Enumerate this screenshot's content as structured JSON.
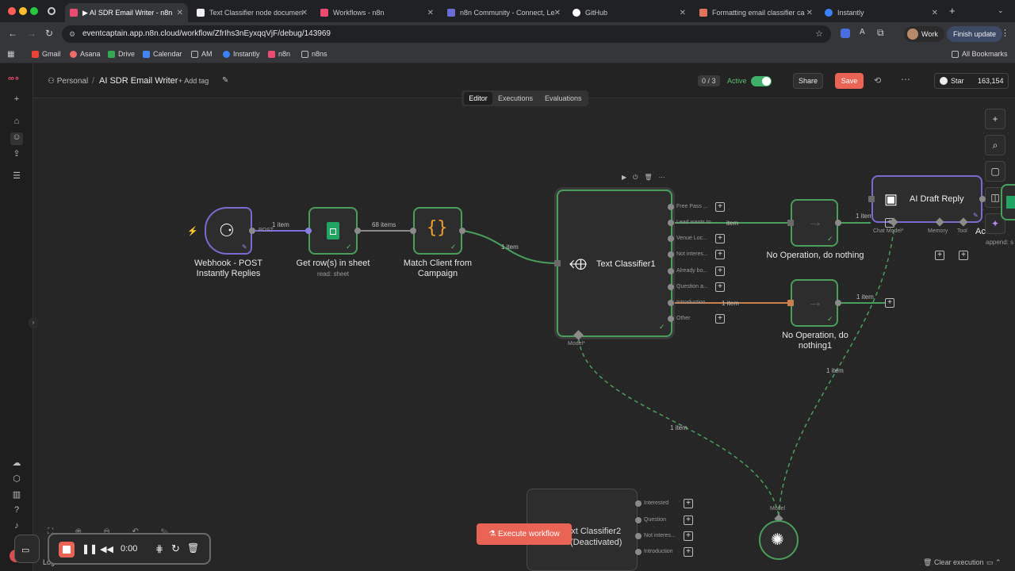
{
  "browser": {
    "tabs": [
      {
        "label": "▶ AI SDR Email Writer - n8n",
        "active": true
      },
      {
        "label": "Text Classifier node documen"
      },
      {
        "label": "Workflows - n8n"
      },
      {
        "label": "n8n Community - Connect, Le"
      },
      {
        "label": "GitHub"
      },
      {
        "label": "Formatting email classifier ca"
      },
      {
        "label": "Instantly"
      }
    ],
    "url": "eventcaptain.app.n8n.cloud/workflow/ZfrIhs3nEyxqqVjF/debug/143969",
    "profile": "Work",
    "finish_update": "Finish update",
    "bookmarks": [
      "Gmail",
      "Asana",
      "Drive",
      "Calendar",
      "AM",
      "Instantly",
      "n8n",
      "n8ns"
    ],
    "all_bookmarks": "All Bookmarks"
  },
  "header": {
    "breadcrumb_owner": "Personal",
    "workflow_name": "AI SDR Email Writer",
    "add_tag": "+ Add tag",
    "counter": "0 / 3",
    "active_label": "Active",
    "share": "Share",
    "save": "Save",
    "star": "Star",
    "star_count": "163,154"
  },
  "tabs": [
    "Editor",
    "Executions",
    "Evaluations"
  ],
  "nodes": {
    "webhook": {
      "title_line1": "Webhook - POST",
      "title_line2": "Instantly Replies",
      "port": "POST"
    },
    "sheet": {
      "title": "Get row(s) in sheet",
      "subtitle": "read: sheet"
    },
    "match": {
      "title_line1": "Match Client from",
      "title_line2": "Campaign"
    },
    "classifier": {
      "title": "Text Classifier1",
      "model_label": "Model*",
      "outputs": [
        "Free Pass ...",
        "Lead wants to ...",
        "Venue Loc...",
        "Not interes...",
        "Already bo...",
        "Question a...",
        "Introduction",
        "Other"
      ]
    },
    "noop1": {
      "title": "No Operation, do nothing"
    },
    "noop2": {
      "title_line1": "No Operation, do",
      "title_line2": "nothing1"
    },
    "draft": {
      "title": "AI Draft Reply",
      "ports": [
        "Chat Model*",
        "Memory",
        "Tool"
      ]
    },
    "partial_right": {
      "title": "Ac",
      "subtitle": "append: s"
    },
    "classifier2": {
      "title_line1": "xt Classifier2",
      "title_line2": "(Deactivated)",
      "outputs": [
        "Interested",
        "Question",
        "Not interes...",
        "Introduction"
      ]
    },
    "model": {
      "label": "Model"
    }
  },
  "edges": {
    "webhook_sheet": "1 item",
    "sheet_match": "68 items",
    "match_classifier": "1 item",
    "lead_noop": "item",
    "noop_draft": "1 item",
    "intro_noop2": "1 item",
    "noop2_out": "1 item",
    "model_classifier": "1 item",
    "model_draft": "1 item"
  },
  "execute_button": "Execute workflow",
  "recorder": {
    "time": "0:00"
  },
  "footer": {
    "logs": "Logs",
    "clear_execution": "Clear execution"
  }
}
